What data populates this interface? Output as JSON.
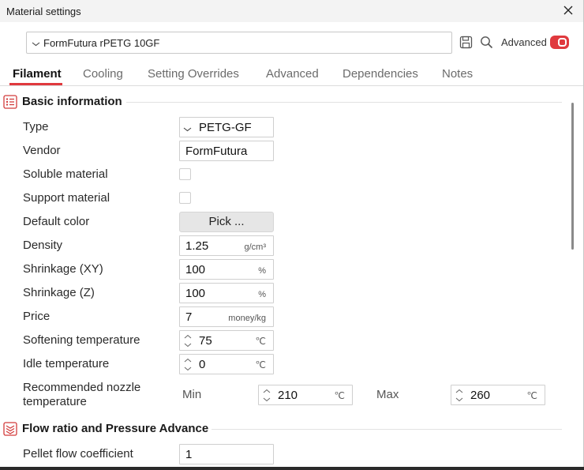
{
  "window": {
    "title": "Material settings"
  },
  "preset": {
    "value": "FormFutura rPETG 10GF"
  },
  "toolbar": {
    "advanced_label": "Advanced",
    "advanced_on": true
  },
  "tabs": [
    {
      "label": "Filament",
      "active": true
    },
    {
      "label": "Cooling",
      "active": false
    },
    {
      "label": "Setting Overrides",
      "active": false
    },
    {
      "label": "Advanced",
      "active": false
    },
    {
      "label": "Dependencies",
      "active": false
    },
    {
      "label": "Notes",
      "active": false
    }
  ],
  "sections": {
    "basic": {
      "title": "Basic information"
    },
    "flow": {
      "title": "Flow ratio and Pressure Advance"
    }
  },
  "fields": {
    "type": {
      "label": "Type",
      "value": "PETG-GF"
    },
    "vendor": {
      "label": "Vendor",
      "value": "FormFutura"
    },
    "soluble": {
      "label": "Soluble material",
      "checked": false
    },
    "support": {
      "label": "Support material",
      "checked": false
    },
    "color": {
      "label": "Default color",
      "button": "Pick ..."
    },
    "density": {
      "label": "Density",
      "value": "1.25",
      "unit": "g/cm³"
    },
    "shrink_xy": {
      "label": "Shrinkage (XY)",
      "value": "100",
      "unit": "%"
    },
    "shrink_z": {
      "label": "Shrinkage (Z)",
      "value": "100",
      "unit": "%"
    },
    "price": {
      "label": "Price",
      "value": "7",
      "unit": "money/kg"
    },
    "softening": {
      "label": "Softening temperature",
      "value": "75",
      "unit": "℃"
    },
    "idle": {
      "label": "Idle temperature",
      "value": "0",
      "unit": "℃"
    },
    "nozzle": {
      "label_line1": "Recommended nozzle",
      "label_line2": "temperature",
      "min_label": "Min",
      "min_value": "210",
      "min_unit": "℃",
      "max_label": "Max",
      "max_value": "260",
      "max_unit": "℃"
    },
    "pellet": {
      "label": "Pellet flow coefficient",
      "value": "1"
    }
  },
  "colors": {
    "accent": "#e0393e"
  }
}
